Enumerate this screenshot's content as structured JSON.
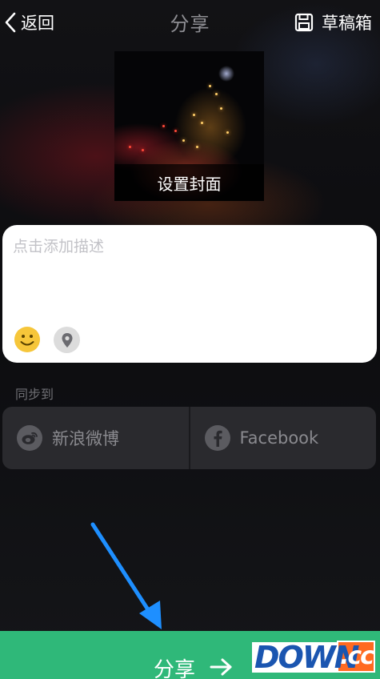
{
  "header": {
    "back_label": "返回",
    "title": "分享",
    "drafts_label": "草稿箱"
  },
  "cover": {
    "caption": "设置封面"
  },
  "description": {
    "placeholder": "点击添加描述",
    "emoji_icon": "smiley-face-icon",
    "location_icon": "location-pin-icon"
  },
  "sync": {
    "label": "同步到",
    "options": [
      {
        "label": "新浪微博",
        "icon": "weibo-icon"
      },
      {
        "label": "Facebook",
        "icon": "facebook-icon"
      }
    ]
  },
  "share_button": {
    "label": "分享",
    "icon": "arrow-right-icon",
    "color": "#2fb879"
  },
  "watermark": {
    "brand": "DOWN",
    "suffix": ".cc"
  },
  "colors": {
    "accent": "#2fb879",
    "annotation_arrow": "#1e8fff"
  }
}
